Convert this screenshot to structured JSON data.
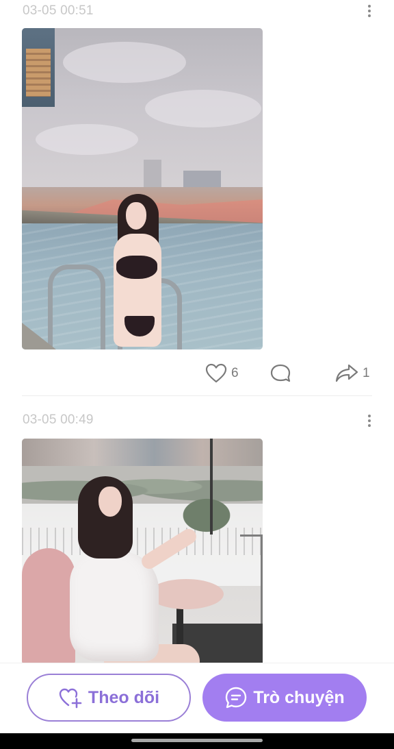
{
  "posts": [
    {
      "time": "03-05 00:51",
      "likes": "6",
      "shares": "1"
    },
    {
      "time": "03-05 00:49"
    }
  ],
  "icons": {
    "more": "more-vertical-icon",
    "like": "heart-icon",
    "comment": "comment-bubble-icon",
    "share": "share-arrow-icon",
    "follow": "heart-plus-icon",
    "chat": "chat-icon"
  },
  "bottom_bar": {
    "follow_label": "Theo dõi",
    "chat_label": "Trò chuyện"
  },
  "colors": {
    "accent": "#a27ef0",
    "accent_text": "#8b6fd8",
    "muted_text": "#c7c7c7",
    "icon_gray": "#7a7a7a"
  }
}
